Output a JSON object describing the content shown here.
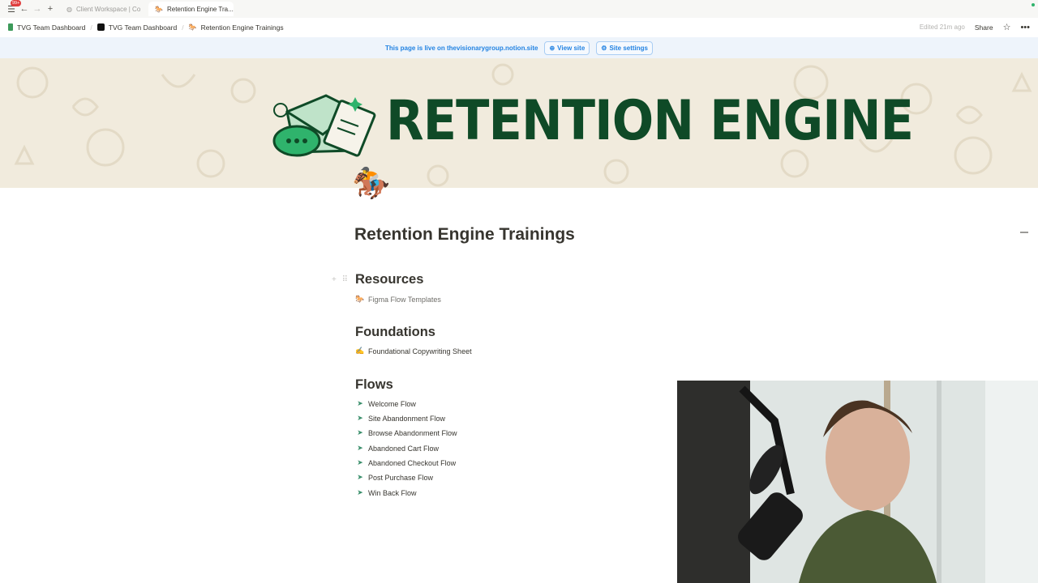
{
  "tabs": {
    "badge": "99+",
    "items": [
      {
        "label": "Client Workspace | Co",
        "icon": "globe-icon",
        "active": false
      },
      {
        "label": "Retention Engine Tra...",
        "icon": "horse-icon",
        "active": true
      }
    ]
  },
  "breadcrumb": {
    "items": [
      {
        "label": "TVG Team Dashboard",
        "icon": "green-square-icon"
      },
      {
        "label": "TVG Team Dashboard",
        "icon": "dark-square-icon"
      },
      {
        "label": "Retention Engine Trainings",
        "icon": "horse-icon"
      }
    ],
    "edited": "Edited 21m ago",
    "share": "Share"
  },
  "live_banner": {
    "text": "This page is live on thevisionarygroup.notion.site",
    "view_site": "View site",
    "site_settings": "Site settings",
    "color": "#2383e2"
  },
  "cover": {
    "title": "RETENTION ENGINE",
    "title_color": "#0f4a27",
    "background": "#f1ebdd"
  },
  "page": {
    "icon": "🏇",
    "title": "Retention Engine Trainings",
    "sections": [
      {
        "heading": "Resources",
        "links": [
          {
            "icon": "🐎",
            "label": "Figma Flow Templates"
          }
        ]
      },
      {
        "heading": "Foundations",
        "links": [
          {
            "icon": "✍️",
            "label": "Foundational Copywriting Sheet"
          }
        ]
      },
      {
        "heading": "Flows",
        "links": [
          {
            "icon": "send-icon",
            "label": "Welcome Flow"
          },
          {
            "icon": "send-icon",
            "label": "Site Abandonment Flow"
          },
          {
            "icon": "send-icon",
            "label": "Browse Abandonment Flow"
          },
          {
            "icon": "send-icon",
            "label": "Abandoned Cart Flow"
          },
          {
            "icon": "send-icon",
            "label": "Abandoned Checkout Flow"
          },
          {
            "icon": "send-icon",
            "label": "Post Purchase Flow"
          },
          {
            "icon": "send-icon",
            "label": "Win Back Flow"
          }
        ]
      }
    ]
  }
}
